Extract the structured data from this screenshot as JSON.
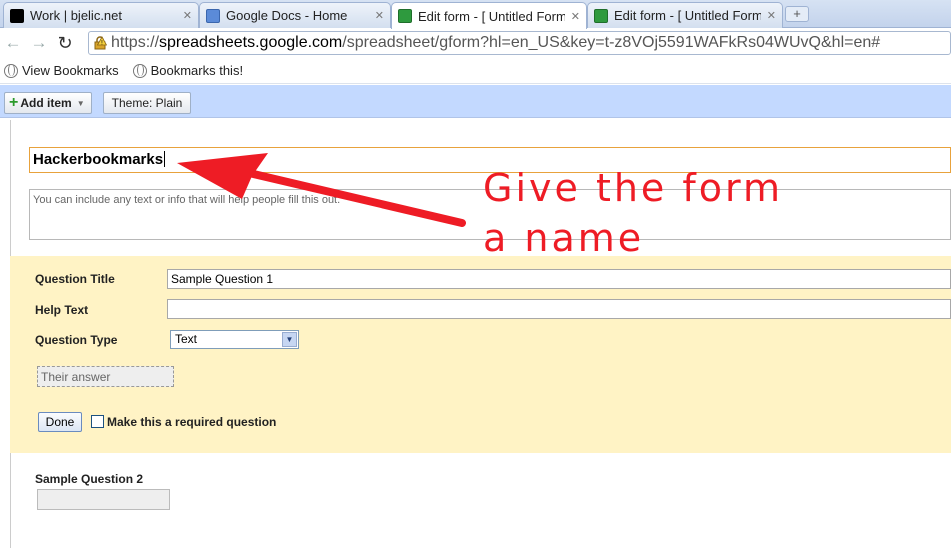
{
  "tabs": [
    {
      "title": "Work | bjelic.net",
      "favicon": "black-square-icon",
      "active": false
    },
    {
      "title": "Google Docs - Home",
      "favicon": "docs-icon",
      "active": false
    },
    {
      "title": "Edit form - [ Untitled Form",
      "favicon": "forms-icon",
      "active": true
    },
    {
      "title": "Edit form - [ Untitled Form",
      "favicon": "forms-icon",
      "active": false
    }
  ],
  "address_bar": {
    "scheme": "https://",
    "host": "spreadsheets.google.com",
    "path": "/spreadsheet/gform?hl=en_US&key=t-z8VOj5591WAFkRs04WUvQ&hl=en#"
  },
  "bookmarks": [
    {
      "label": "View Bookmarks"
    },
    {
      "label": "Bookmarks this!"
    }
  ],
  "appbar": {
    "add_item_label": "Add item",
    "theme_label": "Theme:  Plain"
  },
  "form": {
    "title_value": "Hackerbookmarks",
    "description_placeholder": "You can include any text or info that will help people fill this out."
  },
  "question1": {
    "title_label": "Question Title",
    "title_value": "Sample Question 1",
    "help_label": "Help Text",
    "help_value": "",
    "type_label": "Question Type",
    "type_value": "Text",
    "answer_preview": "Their answer",
    "done_label": "Done",
    "required_label": "Make this a required question",
    "required_checked": false
  },
  "question2": {
    "title": "Sample Question 2"
  },
  "annotation": {
    "line1": "Give the form",
    "line2": "a name",
    "color": "#ee1c25"
  }
}
